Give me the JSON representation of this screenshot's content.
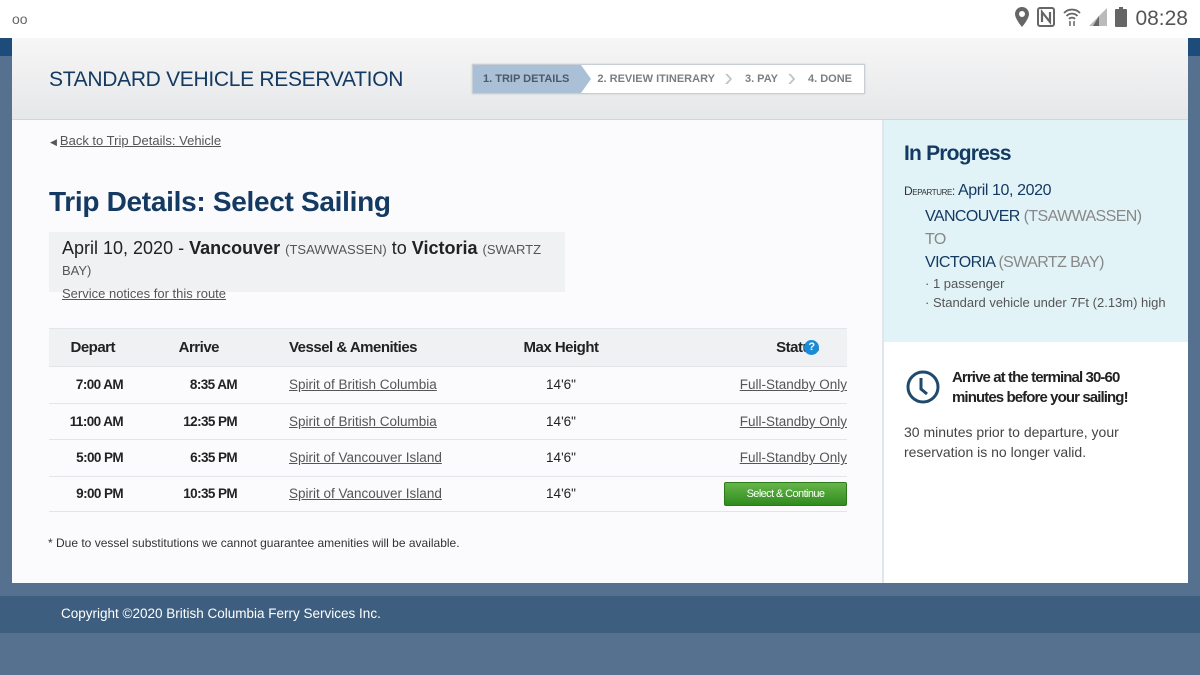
{
  "statusbar": {
    "left_icon": "voicemail-icon",
    "left_glyph": "oo",
    "icons": [
      "location-icon",
      "nfc-icon",
      "wifi-icon",
      "signal-icon",
      "battery-icon"
    ],
    "time": "08:28"
  },
  "header": {
    "title": "STANDARD VEHICLE RESERVATION",
    "steps": [
      {
        "label": "1. TRIP DETAILS",
        "active": true
      },
      {
        "label": "2. REVIEW ITINERARY",
        "active": false
      },
      {
        "label": "3. PAY",
        "active": false
      },
      {
        "label": "4. DONE",
        "active": false
      }
    ]
  },
  "main": {
    "back_link": "Back to Trip Details: Vehicle",
    "page_title": "Trip Details: Select Sailing",
    "route": {
      "date": "April 10, 2020 -",
      "from_city": "Vancouver",
      "from_terminal": "(TSAWWASSEN)",
      "to_word": "to",
      "to_city": "Victoria",
      "to_terminal": "(SWARTZ BAY)",
      "notices_link": "Service notices for this route"
    },
    "table": {
      "headers": {
        "depart": "Depart",
        "arrive": "Arrive",
        "vessel": "Vessel & Amenities",
        "max_height": "Max Height",
        "status": "Status"
      },
      "help_glyph": "?",
      "rows": [
        {
          "depart": "7:00 AM",
          "arrive": "8:35 AM",
          "vessel": "Spirit of British Columbia",
          "max_height": "14'6\"",
          "status": "Full-Standby Only",
          "status_type": "link"
        },
        {
          "depart": "11:00 AM",
          "arrive": "12:35 PM",
          "vessel": "Spirit of British Columbia",
          "max_height": "14'6\"",
          "status": "Full-Standby Only",
          "status_type": "link"
        },
        {
          "depart": "5:00 PM",
          "arrive": "6:35 PM",
          "vessel": "Spirit of Vancouver Island",
          "max_height": "14'6\"",
          "status": "Full-Standby Only",
          "status_type": "link"
        },
        {
          "depart": "9:00 PM",
          "arrive": "10:35 PM",
          "vessel": "Spirit of Vancouver Island",
          "max_height": "14'6\"",
          "status": "Select & Continue",
          "status_type": "button"
        }
      ]
    },
    "footnote": "* Due to vessel substitutions we cannot guarantee amenities will be available."
  },
  "sidebar": {
    "title": "In Progress",
    "departure_label": "Departure:",
    "departure_date": "April 10, 2020",
    "from_city": "VANCOUVER",
    "from_terminal": "(TSAWWASSEN)",
    "to_word": "TO",
    "to_city": "VICTORIA",
    "to_terminal": "(SWARTZ BAY)",
    "bullets": [
      "· 1 passenger",
      "· Standard vehicle under 7Ft (2.13m) high"
    ],
    "arrive_title": "Arrive at the terminal 30-60 minutes before your sailing!",
    "arrive_text": "30 minutes prior to departure, your reservation is no longer valid."
  },
  "footer": {
    "copyright": "Copyright ©2020 British Columbia Ferry Services Inc."
  },
  "colors": {
    "brand_navy": "#143a62",
    "active_step": "#a9c0d6",
    "select_button": "#3f9a2c",
    "help_icon": "#1a8bd4",
    "sidebar_bg": "#e2f3f8",
    "page_bg": "#56708f",
    "footer_band": "#3d5e7e"
  }
}
